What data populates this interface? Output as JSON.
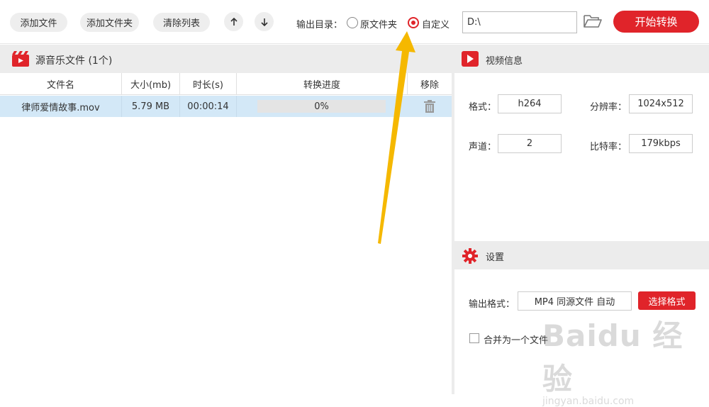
{
  "toolbar": {
    "add_file": "添加文件",
    "add_folder": "添加文件夹",
    "clear_list": "清除列表",
    "output_dir_label": "输出目录：",
    "radio_original": "原文件夹",
    "radio_custom": "自定义",
    "selected_radio": "custom",
    "path_value": "D:\\",
    "start_button": "开始转换"
  },
  "file_panel": {
    "title": "源音乐文件 (1个)",
    "columns": [
      "文件名",
      "大小(mb)",
      "时长(s)",
      "转换进度",
      "移除"
    ],
    "rows": [
      {
        "name": "律师爱情故事.mov",
        "size": "5.79 MB",
        "duration": "00:00:14",
        "progress_text": "0%",
        "progress": 0
      }
    ]
  },
  "video_info": {
    "title": "视频信息",
    "format_label": "格式：",
    "format_value": "h264",
    "resolution_label": "分辨率：",
    "resolution_value": "1024x512",
    "channels_label": "声道：",
    "channels_value": "2",
    "bitrate_label": "比特率：",
    "bitrate_value": "179kbps"
  },
  "settings": {
    "title": "设置",
    "output_format_label": "输出格式：",
    "output_format_value": "MP4 同源文件 自动",
    "select_format_button": "选择格式",
    "merge_checkbox_label": "合并为一个文件",
    "merge_checked": false
  },
  "watermark": {
    "main": "Baidu 经验",
    "sub": "jingyan.baidu.com"
  },
  "colors": {
    "accent": "#e0242a",
    "row_selected": "#d3e8f7",
    "annotation_arrow": "#f5b800"
  }
}
